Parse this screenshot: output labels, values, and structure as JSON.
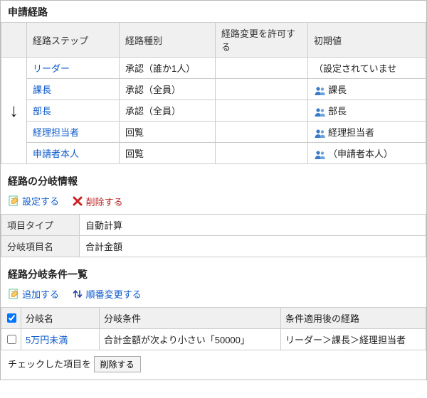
{
  "sections": {
    "route_title": "申請経路",
    "branch_info_title": "経路の分岐情報",
    "branch_cond_title": "経路分岐条件一覧"
  },
  "route_table": {
    "headers": {
      "step": "経路ステップ",
      "kind": "経路種別",
      "allow_change": "経路変更を許可する",
      "default": "初期値"
    },
    "rows": [
      {
        "step": "リーダー",
        "kind": "承認（誰か1人）",
        "allow": "",
        "default": "（設定されていませ",
        "has_icon": false
      },
      {
        "step": "課長",
        "kind": "承認（全員）",
        "allow": "",
        "default": "課長",
        "has_icon": true
      },
      {
        "step": "部長",
        "kind": "承認（全員）",
        "allow": "",
        "default": "部長",
        "has_icon": true
      },
      {
        "step": "経理担当者",
        "kind": "回覧",
        "allow": "",
        "default": "経理担当者",
        "has_icon": true
      },
      {
        "step": "申請者本人",
        "kind": "回覧",
        "allow": "",
        "default": "（申請者本人）",
        "has_icon": true
      }
    ]
  },
  "branch_actions": {
    "configure": "設定する",
    "delete": "削除する"
  },
  "branch_kv": {
    "item_type_label": "項目タイプ",
    "item_type_value": "自動計算",
    "branch_field_label": "分岐項目名",
    "branch_field_value": "合計金額"
  },
  "cond_actions": {
    "add": "追加する",
    "reorder": "順番変更する"
  },
  "cond_table": {
    "headers": {
      "name": "分岐名",
      "cond": "分岐条件",
      "after": "条件適用後の経路"
    },
    "rows": [
      {
        "name": "5万円未満",
        "cond": "合計金額が次より小さい「50000」",
        "after": "リーダー＞課長＞経理担当者"
      }
    ]
  },
  "footer": {
    "checked_label": "チェックした項目を",
    "delete_btn": "削除する"
  }
}
